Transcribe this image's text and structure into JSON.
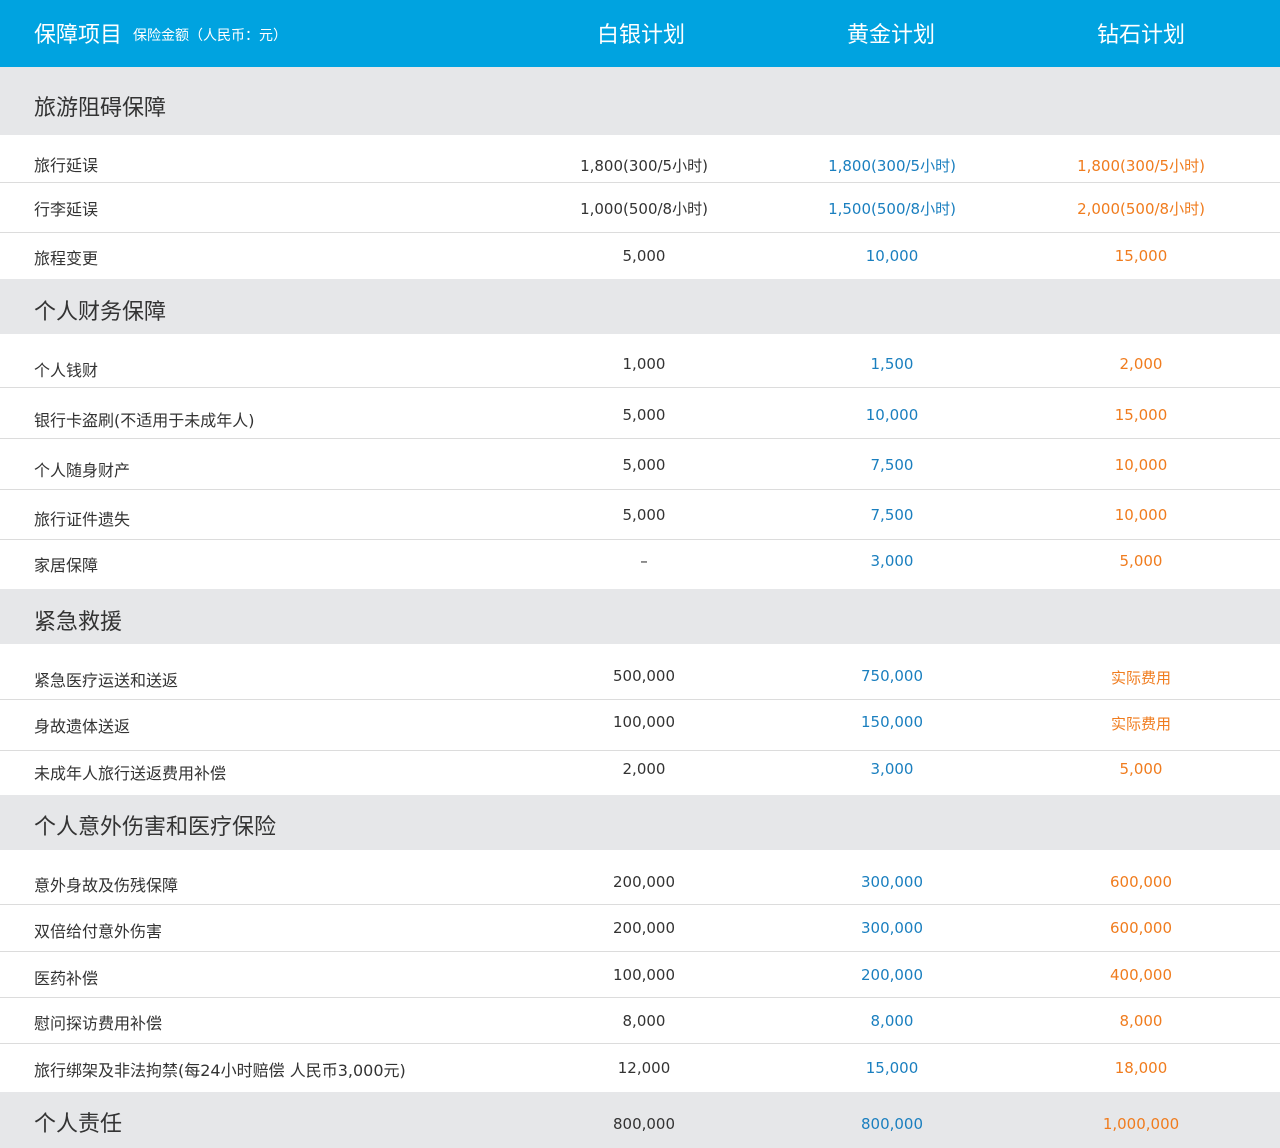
{
  "colors": {
    "header_bg": "#00a3e0",
    "section_bg": "#e6e7e9",
    "silver_text": "#333333",
    "gold_text": "#1a7fbf",
    "diamond_text": "#f07c1e"
  },
  "header": {
    "title": "保障项目",
    "subtitle": "保险金额（人民币：元）",
    "plans": [
      "白银计划",
      "黄金计划",
      "钻石计划"
    ]
  },
  "sections": [
    {
      "title": "旅游阻碍保障",
      "rows": [
        {
          "label": "旅行延误",
          "silver": "1,800(300/5小时)",
          "gold": "1,800(300/5小时)",
          "diamond": "1,800(300/5小时)"
        },
        {
          "label": "行李延误",
          "silver": "1,000(500/8小时)",
          "gold": "1,500(500/8小时)",
          "diamond": "2,000(500/8小时)"
        },
        {
          "label": "旅程变更",
          "silver": "5,000",
          "gold": "10,000",
          "diamond": "15,000"
        }
      ]
    },
    {
      "title": "个人财务保障",
      "rows": [
        {
          "label": "个人钱财",
          "silver": "1,000",
          "gold": "1,500",
          "diamond": "2,000"
        },
        {
          "label": "银行卡盗刷(不适用于未成年人)",
          "silver": "5,000",
          "gold": "10,000",
          "diamond": "15,000"
        },
        {
          "label": "个人随身财产",
          "silver": "5,000",
          "gold": "7,500",
          "diamond": "10,000"
        },
        {
          "label": "旅行证件遗失",
          "silver": "5,000",
          "gold": "7,500",
          "diamond": "10,000"
        },
        {
          "label": "家居保障",
          "silver": "–",
          "gold": "3,000",
          "diamond": "5,000"
        }
      ]
    },
    {
      "title": "紧急救援",
      "rows": [
        {
          "label": "紧急医疗运送和送返",
          "silver": "500,000",
          "gold": "750,000",
          "diamond": "实际费用"
        },
        {
          "label": "身故遗体送返",
          "silver": "100,000",
          "gold": "150,000",
          "diamond": "实际费用"
        },
        {
          "label": "未成年人旅行送返费用补偿",
          "silver": "2,000",
          "gold": "3,000",
          "diamond": "5,000"
        }
      ]
    },
    {
      "title": "个人意外伤害和医疗保险",
      "rows": [
        {
          "label": "意外身故及伤残保障",
          "silver": "200,000",
          "gold": "300,000",
          "diamond": "600,000"
        },
        {
          "label": "双倍给付意外伤害",
          "silver": "200,000",
          "gold": "300,000",
          "diamond": "600,000"
        },
        {
          "label": "医药补偿",
          "silver": "100,000",
          "gold": "200,000",
          "diamond": "400,000"
        },
        {
          "label": "慰问探访费用补偿",
          "silver": "8,000",
          "gold": "8,000",
          "diamond": "8,000"
        },
        {
          "label": "旅行绑架及非法拘禁(每24小时赔偿 人民币3,000元)",
          "silver": "12,000",
          "gold": "15,000",
          "diamond": "18,000"
        }
      ]
    },
    {
      "title": "个人责任",
      "inline": {
        "silver": "800,000",
        "gold": "800,000",
        "diamond": "1,000,000"
      }
    }
  ]
}
